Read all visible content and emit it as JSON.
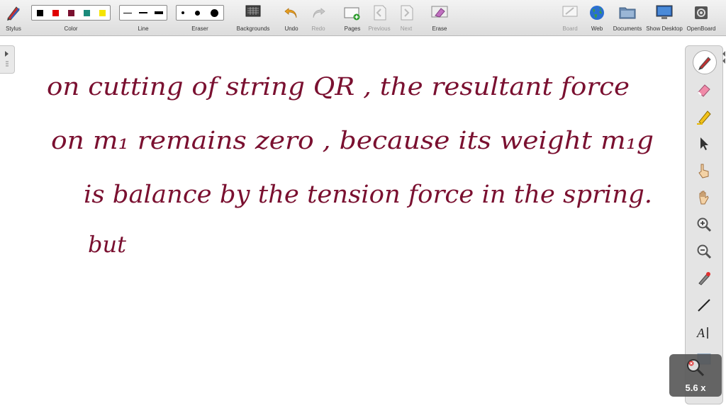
{
  "toolbar": {
    "stylus": "Stylus",
    "color": "Color",
    "line": "Line",
    "eraser": "Eraser",
    "backgrounds": "Backgrounds",
    "undo": "Undo",
    "redo": "Redo",
    "pages": "Pages",
    "previous": "Previous",
    "next": "Next",
    "erase": "Erase",
    "board": "Board",
    "web": "Web",
    "documents": "Documents",
    "show_desktop": "Show Desktop",
    "openboard": "OpenBoard"
  },
  "colors": [
    "#000000",
    "#e00000",
    "#7a1030",
    "#1a8a7a",
    "#f5e400"
  ],
  "ink_color": "#7a1030",
  "board": {
    "lines": [
      "on cutting of string QR , the resultant force",
      "on m₁ remains zero , because its weight m₁g",
      "is balance by the tension force in the spring.",
      "but"
    ]
  },
  "zoom": {
    "label": "5.6 x"
  },
  "tools": [
    "pen-icon",
    "eraser-icon",
    "highlighter-icon",
    "pointer-icon",
    "hand-pointer-icon",
    "hand-icon",
    "zoom-in-icon",
    "zoom-out-icon",
    "laser-icon",
    "line-icon",
    "text-icon"
  ]
}
